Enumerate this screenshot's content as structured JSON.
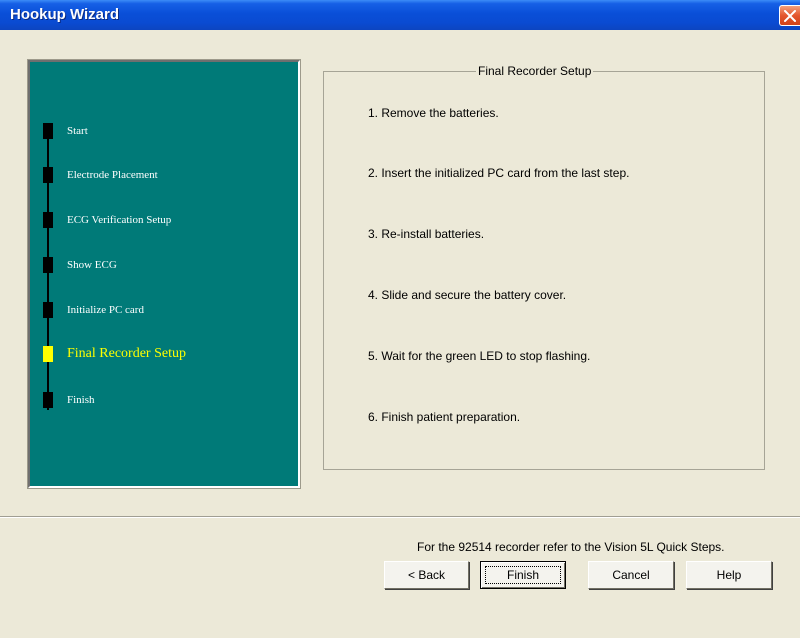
{
  "window": {
    "title": "Hookup Wizard",
    "close_icon": "close-icon"
  },
  "steps": [
    {
      "label": "Start",
      "active": false
    },
    {
      "label": "Electrode Placement",
      "active": false
    },
    {
      "label": "ECG Verification Setup",
      "active": false
    },
    {
      "label": "Show ECG",
      "active": false
    },
    {
      "label": "Initialize PC card",
      "active": false
    },
    {
      "label": "Final Recorder Setup",
      "active": true
    },
    {
      "label": "Finish",
      "active": false
    }
  ],
  "colors": {
    "panel": "#007a78",
    "active_step": "#ffff00",
    "titlebar": "#0a4fd8"
  },
  "group": {
    "title": "Final Recorder Setup",
    "instructions": [
      "1. Remove the batteries.",
      "2. Insert the initialized PC card from the last step.",
      "3. Re-install batteries.",
      "4. Slide and secure the battery cover.",
      "5. Wait for the green LED to stop flashing.",
      "6. Finish patient preparation."
    ]
  },
  "note": "For the 92514 recorder refer to the Vision 5L Quick Steps.",
  "buttons": {
    "back": "< Back",
    "finish": "Finish",
    "cancel": "Cancel",
    "help": "Help"
  }
}
